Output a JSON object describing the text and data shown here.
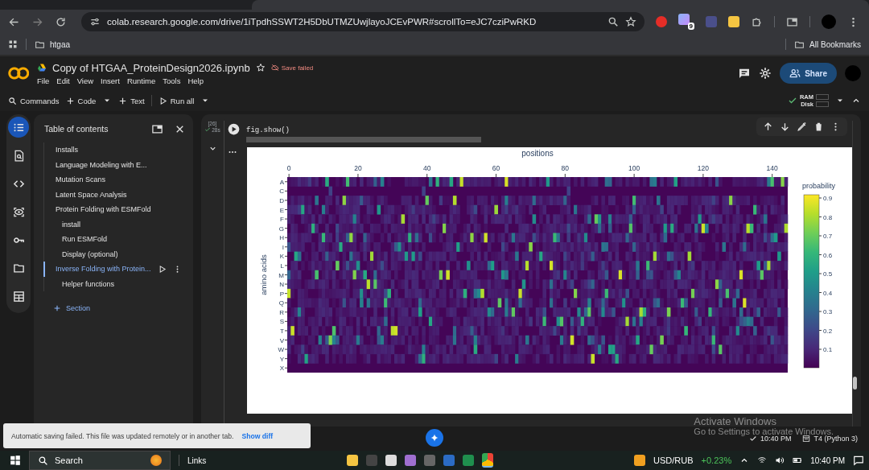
{
  "browser": {
    "url": "colab.research.google.com/drive/1iTpdhSSWT2H5DbUTMZUwjlayoJCEvPWR#scrollTo=eJC7cziPwRKD",
    "extension_badge": "9",
    "bookmarks": [
      "htgaa"
    ],
    "all_bookmarks": "All Bookmarks"
  },
  "notebook": {
    "title": "Copy of HTGAA_ProteinDesign2026.ipynb",
    "save_status": "Save failed",
    "menu": [
      "File",
      "Edit",
      "View",
      "Insert",
      "Runtime",
      "Tools",
      "Help"
    ],
    "share": "Share"
  },
  "toolbar": {
    "commands": "Commands",
    "code": "Code",
    "text": "Text",
    "run_all": "Run all",
    "ram": "RAM",
    "disk": "Disk"
  },
  "rail": [
    {
      "kind": "toc",
      "selected": true
    },
    {
      "kind": "find",
      "selected": false
    },
    {
      "kind": "code",
      "selected": false
    },
    {
      "kind": "variables",
      "selected": false
    },
    {
      "kind": "secrets",
      "selected": false
    },
    {
      "kind": "files",
      "selected": false
    },
    {
      "kind": "table",
      "selected": false
    }
  ],
  "toc": {
    "title": "Table of contents",
    "items": [
      {
        "label": "Installs",
        "selected": false
      },
      {
        "label": "Language Modeling with E...",
        "selected": false
      },
      {
        "label": "Mutation Scans",
        "selected": false
      },
      {
        "label": "Latent Space Analysis",
        "selected": false
      },
      {
        "label": "Protein Folding with ESMFold",
        "selected": false,
        "children": [
          {
            "label": "install",
            "selected": false
          },
          {
            "label": "Run ESMFold",
            "selected": false
          },
          {
            "label": "Display (optional)",
            "selected": false
          }
        ]
      },
      {
        "label": "Inverse Folding with Protein...",
        "selected": true,
        "children": [
          {
            "label": "Helper functions",
            "selected": false
          }
        ]
      }
    ],
    "add_section": "Section"
  },
  "cell": {
    "exec_count": "[26]",
    "duration": "28s",
    "code": "fig.show()"
  },
  "heatmap": {
    "x_title": "positions",
    "x_ticks": [
      "0",
      "20",
      "40",
      "60",
      "80",
      "100",
      "120",
      "140"
    ],
    "y_title": "amino acids",
    "y_labels": [
      "A",
      "C",
      "D",
      "E",
      "F",
      "G",
      "H",
      "I",
      "K",
      "L",
      "M",
      "N",
      "P",
      "Q",
      "R",
      "S",
      "T",
      "V",
      "W",
      "Y",
      "X"
    ],
    "colorbar_title": "probability",
    "colorbar_ticks": [
      "0.9",
      "0.8",
      "0.7",
      "0.6",
      "0.5",
      "0.4",
      "0.3",
      "0.2",
      "0.1"
    ]
  },
  "toast": {
    "message": "Automatic saving failed. This file was updated remotely or in another tab.",
    "action": "Show diff"
  },
  "os_notice": {
    "title": "Activate Windows",
    "text": "Go to Settings to activate Windows."
  },
  "status": {
    "time": "10:40 PM",
    "runtime": "T4 (Python 3)"
  },
  "taskbar": {
    "search": "Search",
    "links": "Links",
    "ticker": "USD/RUB",
    "change": "+0.23%",
    "clock": "10:40 PM"
  }
}
